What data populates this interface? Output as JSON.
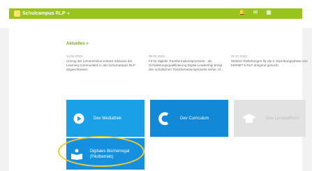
{
  "app": {
    "title": "Schulcampus RLP",
    "caret": "▾"
  },
  "topbar": {
    "icons": [
      "bell-icon",
      "mail-icon",
      "grid-icon"
    ],
    "bell_glyph": "🔔",
    "mail_glyph": "✉",
    "grid_glyph": "▦"
  },
  "news": {
    "heading": "Aktuelles »",
    "items": [
      {
        "date": "14.06.2023",
        "text": "Umzug der LernenOnline-Instanz inklusive der Learning Communities in den Schulcampus RLP abgeschlossen"
      },
      {
        "date": "08.08.2023",
        "text": "Fit für digitale Transformationsprozesse - die Schulleitungsqualifizierung Digital Leadership bringt den schulischen Transformationsprozess sicher, ef..."
      },
      {
        "date": "21.07.2023",
        "text": "Weitere Testlehungen für die 2. Erprobungsphase von KERMIT 5 RLP dringend gesucht"
      }
    ]
  },
  "tiles": [
    {
      "label": "Dev Mediathek",
      "icon": "play-icon"
    },
    {
      "label": "Dev Curriculum",
      "icon": "curriculum-c-icon"
    },
    {
      "label": "Dev Lernplattform",
      "icon": "graduation-cap-icon"
    },
    {
      "label": "Digitales Bücherregal (Pilotbetrieb)",
      "icon": "book-reader-icon"
    }
  ],
  "colors": {
    "accent": "#9ac31c",
    "tile_blue": "#1aa0e6",
    "highlight": "#f2cb2a"
  }
}
